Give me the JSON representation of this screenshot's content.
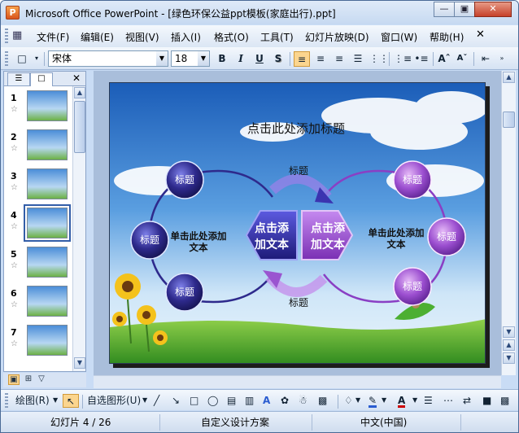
{
  "window": {
    "title": "Microsoft Office PowerPoint - [绿色环保公益ppt模板(家庭出行).ppt]",
    "app_icon": "P"
  },
  "menu": {
    "items": [
      "文件(F)",
      "编辑(E)",
      "视图(V)",
      "插入(I)",
      "格式(O)",
      "工具(T)",
      "幻灯片放映(D)",
      "窗口(W)",
      "帮助(H)"
    ]
  },
  "format_toolbar": {
    "font_name": "宋体",
    "font_size": "18",
    "bold": "B",
    "italic": "I",
    "underline": "U",
    "shadow": "S"
  },
  "left_pane": {
    "slides": [
      {
        "num": "1",
        "star": "☆"
      },
      {
        "num": "2",
        "star": "☆"
      },
      {
        "num": "3",
        "star": "☆"
      },
      {
        "num": "4",
        "star": "☆"
      },
      {
        "num": "5",
        "star": "☆"
      },
      {
        "num": "6",
        "star": "☆"
      },
      {
        "num": "7",
        "star": "☆"
      }
    ],
    "selected_index": 4
  },
  "slide": {
    "title": "点击此处添加标题",
    "center_left": [
      "点击添",
      "加文本"
    ],
    "center_right": [
      "点击添",
      "加文本"
    ],
    "left_text": [
      "单击此处添加",
      "文本"
    ],
    "right_text": [
      "单击此处添加",
      "文本"
    ],
    "circle_label": "标题",
    "arrow_top_label": "标题",
    "arrow_bottom_label": "标题"
  },
  "drawing_toolbar": {
    "draw_label": "绘图(R)",
    "autoshapes_label": "自选图形(U)"
  },
  "status": {
    "slide_info": "幻灯片 4 / 26",
    "design": "自定义设计方案",
    "language": "中文(中国)"
  },
  "colors": {
    "accent_blue": "#2e2a8c",
    "accent_purple": "#8a3fc4",
    "title_bar": "#c6d9f1",
    "selected_tool": "#fbd58e"
  }
}
